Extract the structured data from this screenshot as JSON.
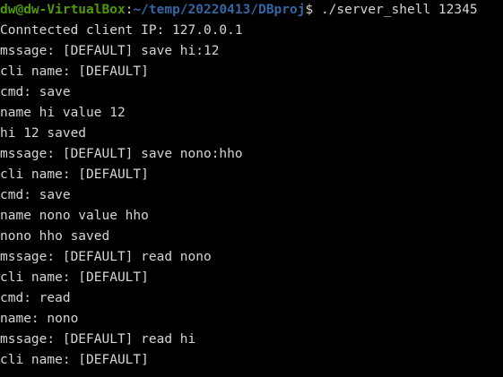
{
  "prompt": {
    "user_host": "dw@dw-VirtualBox",
    "colon": ":",
    "path": "~/temp/20220413/DBproj",
    "dollar": "$ ",
    "command": "./server_shell 12345"
  },
  "output_lines": [
    "Conntected client IP: 127.0.0.1",
    "mssage: [DEFAULT] save hi:12",
    "cli name: [DEFAULT]",
    "cmd: save",
    "name hi value 12",
    "hi 12 saved",
    "mssage: [DEFAULT] save nono:hho",
    "cli name: [DEFAULT]",
    "cmd: save",
    "name nono value hho",
    "nono hho saved",
    "mssage: [DEFAULT] read nono",
    "cli name: [DEFAULT]",
    "cmd: read",
    "name: nono",
    "mssage: [DEFAULT] read hi",
    "cli name: [DEFAULT]"
  ],
  "colors": {
    "background": "#000000",
    "foreground": "#d3d7cf",
    "prompt_user": "#4e9a06",
    "prompt_path": "#3465a4"
  }
}
